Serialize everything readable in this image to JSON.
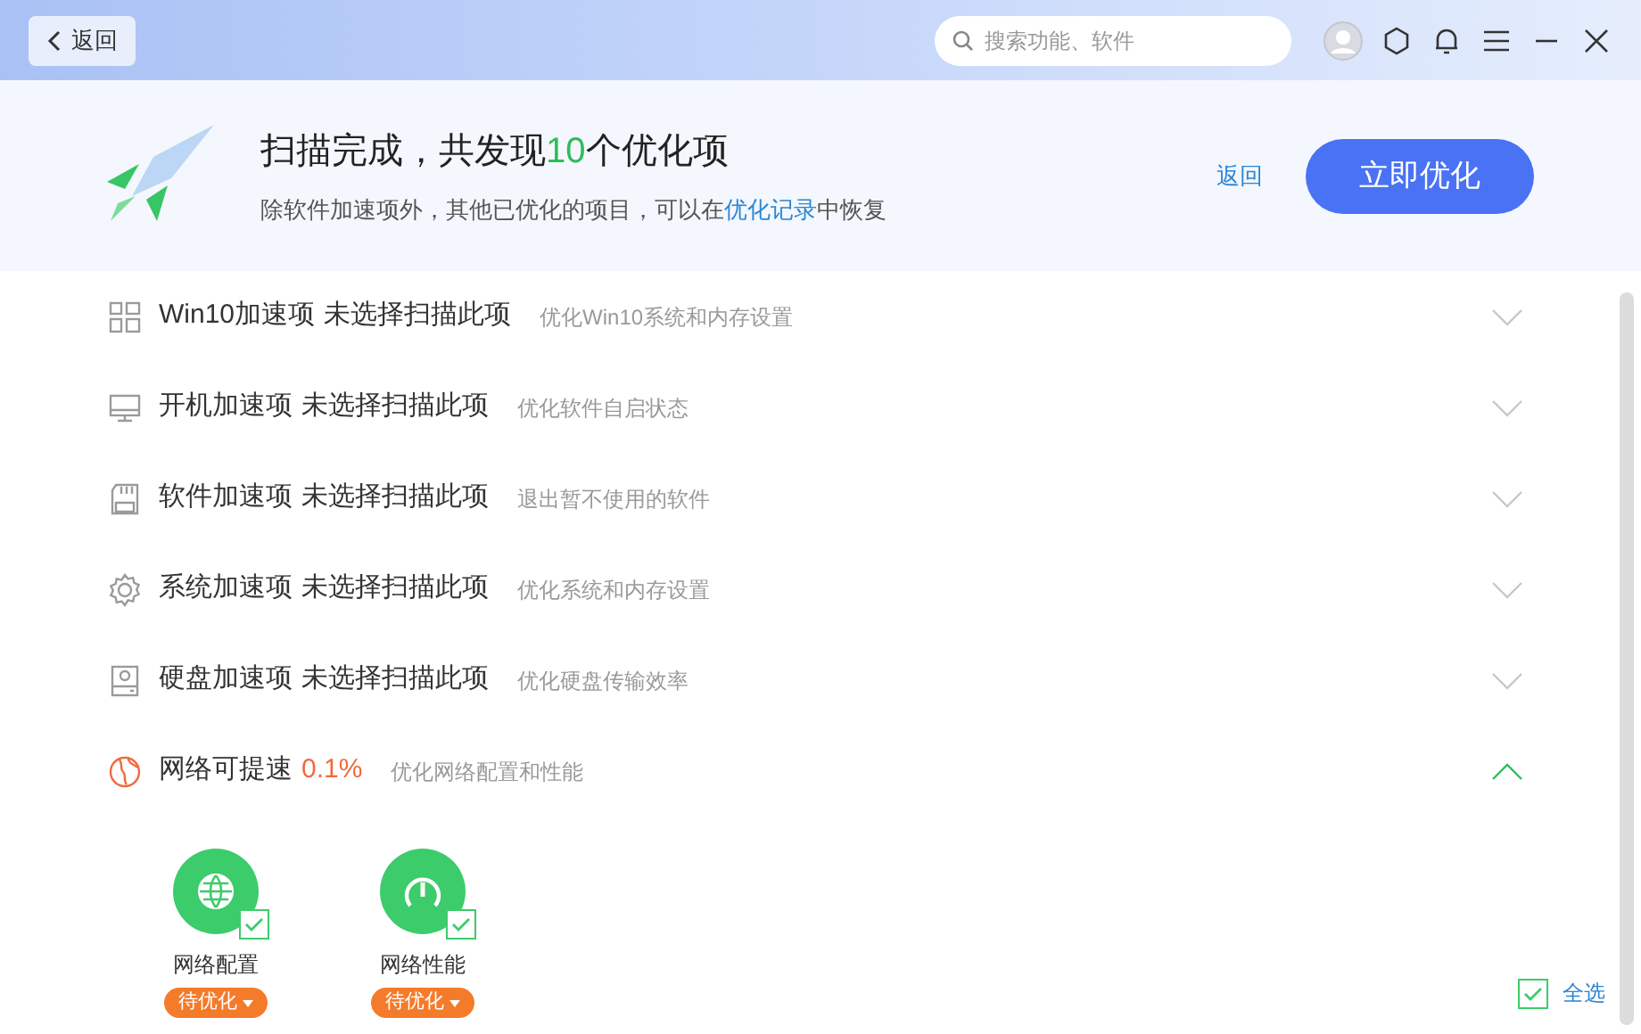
{
  "titlebar": {
    "back_button": "返回",
    "search": {
      "placeholder": "搜索功能、软件"
    }
  },
  "summary": {
    "title_prefix": "扫描完成，共发现",
    "count": "10",
    "title_suffix": "个优化项",
    "note_prefix": "除软件加速项外，其他已优化的项目，可以在",
    "note_link": "优化记录",
    "note_suffix": "中恢复",
    "back_link": "返回",
    "optimize_button": "立即优化"
  },
  "categories": [
    {
      "kind": "unscanned",
      "name": "Win10加速项",
      "status": "未选择扫描此项",
      "description": "优化Win10系统和内存设置",
      "expanded": false
    },
    {
      "kind": "unscanned",
      "name": "开机加速项",
      "status": "未选择扫描此项",
      "description": "优化软件自启状态",
      "expanded": false
    },
    {
      "kind": "unscanned",
      "name": "软件加速项",
      "status": "未选择扫描此项",
      "description": "退出暂不使用的软件",
      "expanded": false
    },
    {
      "kind": "unscanned",
      "name": "系统加速项",
      "status": "未选择扫描此项",
      "description": "优化系统和内存设置",
      "expanded": false
    },
    {
      "kind": "unscanned",
      "name": "硬盘加速项",
      "status": "未选择扫描此项",
      "description": "优化硬盘传输效率",
      "expanded": false
    },
    {
      "kind": "result",
      "name": "网络可提速",
      "status": "0.1%",
      "description": "优化网络配置和性能",
      "expanded": true,
      "children": [
        {
          "name": "网络配置",
          "status": "待优化",
          "checked": true
        },
        {
          "name": "网络性能",
          "status": "待优化",
          "checked": true
        }
      ]
    }
  ],
  "select_all": {
    "label": "全选",
    "checked": true
  }
}
